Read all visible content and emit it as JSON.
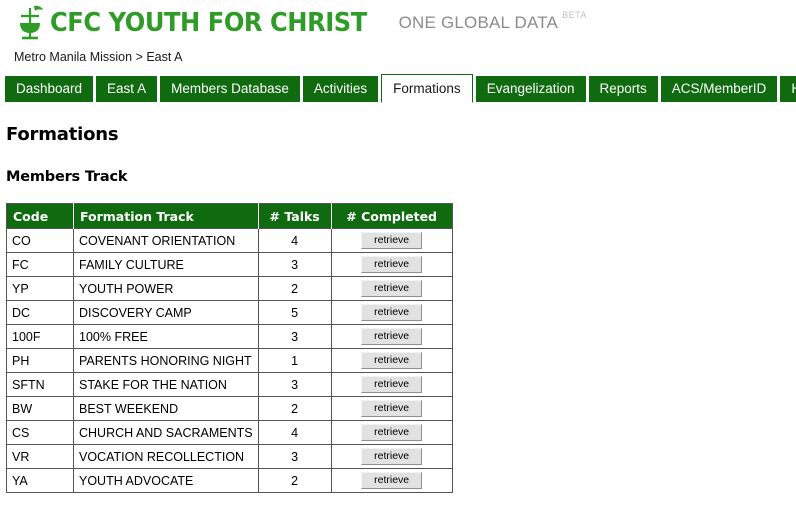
{
  "brand": {
    "logo_icon": "chalice-cross-dove-icon",
    "wordmark": "CFC YOUTH FOR CHRIST",
    "tagline": "ONE GLOBAL DATA",
    "beta_label": "BETA",
    "green": "#2e9c27"
  },
  "breadcrumb": {
    "text": "Metro Manila Mission > East A"
  },
  "tabs": [
    {
      "label": "Dashboard",
      "active": false
    },
    {
      "label": "East A",
      "active": false
    },
    {
      "label": "Members Database",
      "active": false
    },
    {
      "label": "Activities",
      "active": false
    },
    {
      "label": "Formations",
      "active": true
    },
    {
      "label": "Evangelization",
      "active": false
    },
    {
      "label": "Reports",
      "active": false
    },
    {
      "label": "ACS/MemberID",
      "active": false
    },
    {
      "label": "Help",
      "active": false
    }
  ],
  "page": {
    "title": "Formations",
    "section_title": "Members Track",
    "accent_green": "#106b10"
  },
  "table": {
    "headers": [
      "Code",
      "Formation Track",
      "# Talks",
      "# Completed"
    ],
    "action_label": "retrieve",
    "rows": [
      {
        "code": "CO",
        "track": "COVENANT ORIENTATION",
        "talks": "4",
        "action": "retrieve"
      },
      {
        "code": "FC",
        "track": "FAMILY CULTURE",
        "talks": "3",
        "action": "retrieve"
      },
      {
        "code": "YP",
        "track": "YOUTH POWER",
        "talks": "2",
        "action": "retrieve"
      },
      {
        "code": "DC",
        "track": "DISCOVERY CAMP",
        "talks": "5",
        "action": "retrieve"
      },
      {
        "code": "100F",
        "track": "100% FREE",
        "talks": "3",
        "action": "retrieve"
      },
      {
        "code": "PH",
        "track": "PARENTS HONORING NIGHT",
        "talks": "1",
        "action": "retrieve"
      },
      {
        "code": "SFTN",
        "track": "STAKE FOR THE NATION",
        "talks": "3",
        "action": "retrieve"
      },
      {
        "code": "BW",
        "track": "BEST WEEKEND",
        "talks": "2",
        "action": "retrieve"
      },
      {
        "code": "CS",
        "track": "CHURCH AND SACRAMENTS",
        "talks": "4",
        "action": "retrieve"
      },
      {
        "code": "VR",
        "track": "VOCATION RECOLLECTION",
        "talks": "3",
        "action": "retrieve"
      },
      {
        "code": "YA",
        "track": "YOUTH ADVOCATE",
        "talks": "2",
        "action": "retrieve"
      }
    ]
  }
}
